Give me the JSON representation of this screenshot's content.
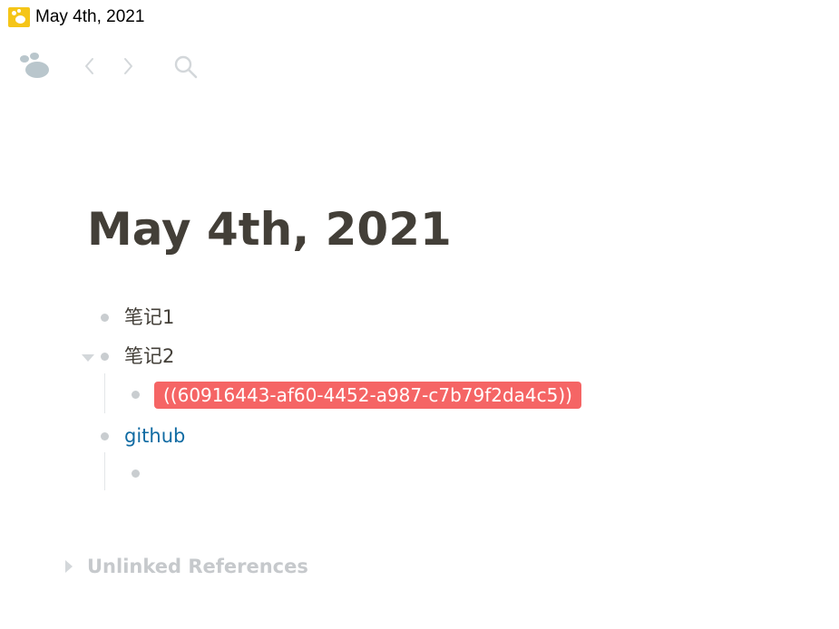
{
  "window": {
    "title": "May 4th, 2021",
    "icon": "app-logo-icon"
  },
  "toolbar": {
    "logo_icon": "logseq-logo-icon",
    "back_icon": "chevron-left-icon",
    "forward_icon": "chevron-right-icon",
    "search_icon": "search-icon"
  },
  "page": {
    "title": "May 4th, 2021",
    "blocks": [
      {
        "text": "笔记1"
      },
      {
        "text": "笔记2",
        "collapsed": false,
        "children": [
          {
            "ref": "((60916443-af60-4452-a987-c7b79f2da4c5))"
          }
        ]
      },
      {
        "text": "github",
        "is_link": true,
        "children": [
          {
            "text": ""
          }
        ]
      }
    ]
  },
  "references": {
    "unlinked_label": "Unlinked References"
  },
  "colors": {
    "text": "#433f38",
    "link": "#106ba3",
    "ref_bg": "#f56565",
    "bullet": "#c9cdd0",
    "muted": "#c6c9cc"
  }
}
